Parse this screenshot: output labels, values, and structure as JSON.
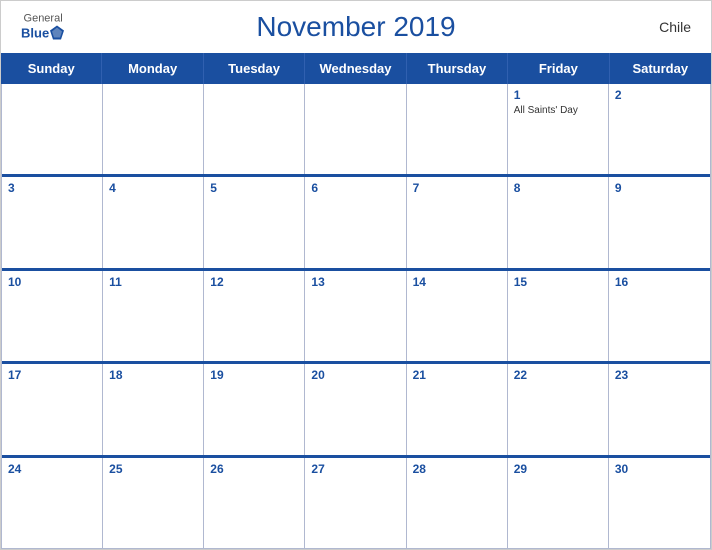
{
  "header": {
    "title": "November 2019",
    "country": "Chile",
    "logo": {
      "general": "General",
      "blue": "Blue"
    }
  },
  "days": [
    "Sunday",
    "Monday",
    "Tuesday",
    "Wednesday",
    "Thursday",
    "Friday",
    "Saturday"
  ],
  "weeks": [
    [
      {
        "date": "",
        "holiday": ""
      },
      {
        "date": "",
        "holiday": ""
      },
      {
        "date": "",
        "holiday": ""
      },
      {
        "date": "",
        "holiday": ""
      },
      {
        "date": "",
        "holiday": ""
      },
      {
        "date": "1",
        "holiday": "All Saints' Day"
      },
      {
        "date": "2",
        "holiday": ""
      }
    ],
    [
      {
        "date": "3",
        "holiday": ""
      },
      {
        "date": "4",
        "holiday": ""
      },
      {
        "date": "5",
        "holiday": ""
      },
      {
        "date": "6",
        "holiday": ""
      },
      {
        "date": "7",
        "holiday": ""
      },
      {
        "date": "8",
        "holiday": ""
      },
      {
        "date": "9",
        "holiday": ""
      }
    ],
    [
      {
        "date": "10",
        "holiday": ""
      },
      {
        "date": "11",
        "holiday": ""
      },
      {
        "date": "12",
        "holiday": ""
      },
      {
        "date": "13",
        "holiday": ""
      },
      {
        "date": "14",
        "holiday": ""
      },
      {
        "date": "15",
        "holiday": ""
      },
      {
        "date": "16",
        "holiday": ""
      }
    ],
    [
      {
        "date": "17",
        "holiday": ""
      },
      {
        "date": "18",
        "holiday": ""
      },
      {
        "date": "19",
        "holiday": ""
      },
      {
        "date": "20",
        "holiday": ""
      },
      {
        "date": "21",
        "holiday": ""
      },
      {
        "date": "22",
        "holiday": ""
      },
      {
        "date": "23",
        "holiday": ""
      }
    ],
    [
      {
        "date": "24",
        "holiday": ""
      },
      {
        "date": "25",
        "holiday": ""
      },
      {
        "date": "26",
        "holiday": ""
      },
      {
        "date": "27",
        "holiday": ""
      },
      {
        "date": "28",
        "holiday": ""
      },
      {
        "date": "29",
        "holiday": ""
      },
      {
        "date": "30",
        "holiday": ""
      }
    ]
  ],
  "colors": {
    "primary_blue": "#1a4fa0",
    "border": "#b0b8d0"
  }
}
